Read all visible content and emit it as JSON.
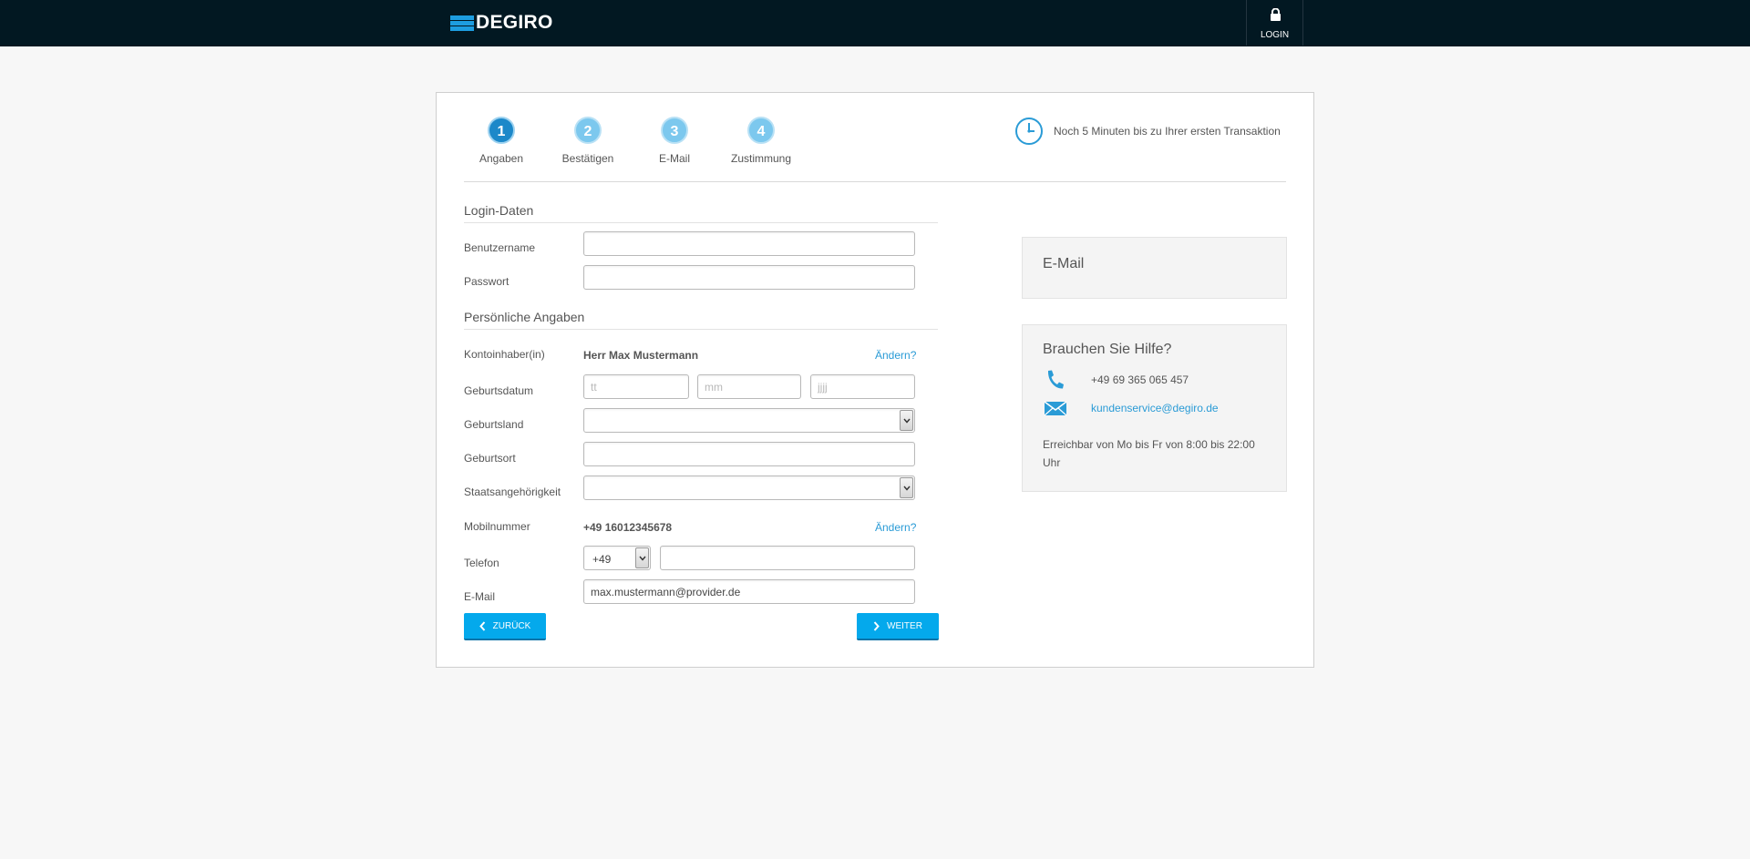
{
  "header": {
    "logo_text": "DEGIRO",
    "login_label": "LOGIN"
  },
  "steps": [
    {
      "number": "1",
      "label": "Angaben",
      "active": true
    },
    {
      "number": "2",
      "label": "Bestätigen",
      "active": false
    },
    {
      "number": "3",
      "label": "E-Mail",
      "active": false
    },
    {
      "number": "4",
      "label": "Zustimmung",
      "active": false
    }
  ],
  "timer_text": "Noch 5 Minuten bis zu Ihrer ersten Transaktion",
  "login_section": {
    "title": "Login-Daten",
    "username_label": "Benutzername",
    "username_value": "",
    "password_label": "Passwort",
    "password_value": ""
  },
  "personal_section": {
    "title": "Persönliche Angaben",
    "account_holder_label": "Kontoinhaber(in)",
    "account_holder_value": "Herr Max Mustermann",
    "change_link": "Ändern?",
    "birthdate_label": "Geburtsdatum",
    "birthdate_day_placeholder": "tt",
    "birthdate_month_placeholder": "mm",
    "birthdate_year_placeholder": "jjjj",
    "birth_country_label": "Geburtsland",
    "birth_country_value": "",
    "birth_place_label": "Geburtsort",
    "birth_place_value": "",
    "nationality_label": "Staatsangehörigkeit",
    "nationality_value": "",
    "mobile_label": "Mobilnummer",
    "mobile_value": "+49 16012345678",
    "phone_label": "Telefon",
    "phone_prefix": "+49",
    "phone_value": "",
    "email_label": "E-Mail",
    "email_value": "max.mustermann@provider.de"
  },
  "buttons": {
    "back": "ZURÜCK",
    "next": "WEITER"
  },
  "sidebar": {
    "email_title": "E-Mail",
    "help_title": "Brauchen Sie Hilfe?",
    "phone": "+49 69 365 065 457",
    "email": "kundenservice@degiro.de",
    "hours": "Erreichbar von Mo bis Fr von 8:00 bis 22:00 Uhr"
  },
  "colors": {
    "topbar": "#021822",
    "accent": "#04a9ec",
    "link": "#2a9bd6",
    "step_active": "#1c88c9",
    "step_inactive": "#7cc8ee"
  }
}
